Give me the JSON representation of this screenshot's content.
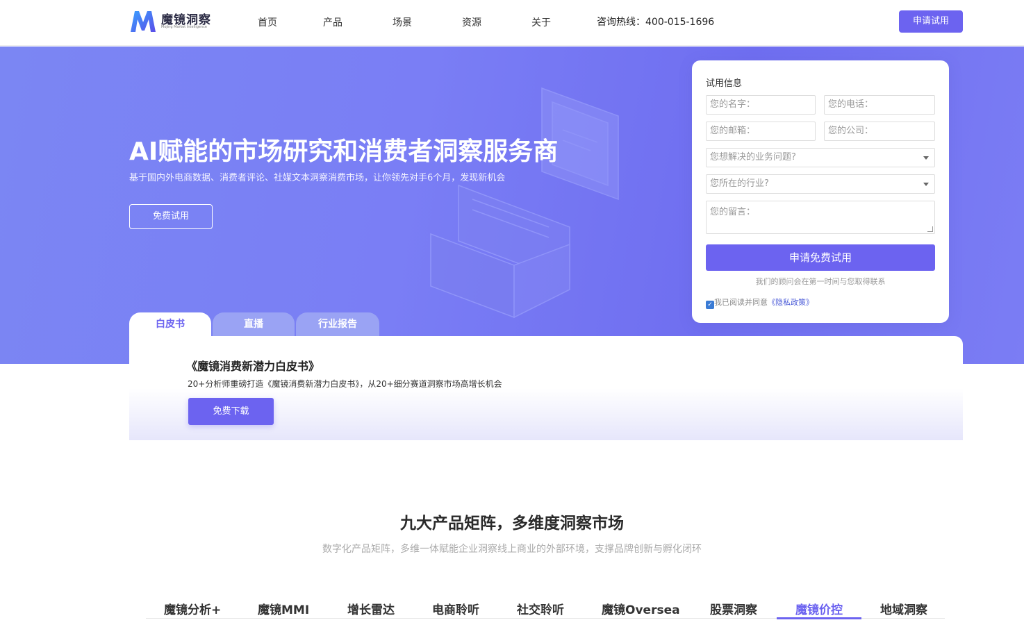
{
  "brand": {
    "name": "魔镜洞察",
    "tagline": "Mojing Market Intelligence",
    "accent": "#6c63f0"
  },
  "nav": {
    "items": [
      {
        "label": "首页"
      },
      {
        "label": "产品"
      },
      {
        "label": "场景"
      },
      {
        "label": "资源"
      },
      {
        "label": "关于"
      }
    ],
    "hotline": "咨询热线：400-015-1696",
    "cta_label": "申请试用"
  },
  "hero": {
    "title": "AI赋能的市场研究和消费者洞察服务商",
    "subtitle": "基于国内外电商数据、消费者评论、社媒文本洞察消费市场，让你领先对手6个月，发现新机会",
    "button_label": "免费试用"
  },
  "form": {
    "title": "试用信息",
    "name_placeholder": "您的名字：",
    "phone_placeholder": "您的电话：",
    "email_placeholder": "您的邮箱：",
    "company_placeholder": "您的公司：",
    "problem_select": "您想解决的业务问题?",
    "industry_select": "您所在的行业?",
    "message_placeholder": "您的留言：",
    "submit_label": "申请免费试用",
    "note": "我们的顾问会在第一时间与您取得联系",
    "agree_text": "我已阅读并同意",
    "privacy_link": "《隐私政策》",
    "agree_checked": true
  },
  "resource_tabs": [
    {
      "label": "白皮书",
      "active": true
    },
    {
      "label": "直播",
      "active": false
    },
    {
      "label": "行业报告",
      "active": false
    }
  ],
  "panel": {
    "title": "《魔镜消费新潜力白皮书》",
    "desc": "20+分析师重磅打造《魔镜消费新潜力白皮书》，从20+细分赛道洞察市场高增长机会",
    "button_label": "免费下载"
  },
  "products": {
    "title": "九大产品矩阵，多维度洞察市场",
    "subtitle": "数字化产品矩阵，多维一体赋能企业洞察线上商业的外部环境，支撑品牌创新与孵化闭环",
    "tabs": [
      {
        "label": "魔镜分析+"
      },
      {
        "label": "魔镜MMI"
      },
      {
        "label": "增长雷达"
      },
      {
        "label": "电商聆听"
      },
      {
        "label": "社交聆听"
      },
      {
        "label": "魔镜Oversea"
      },
      {
        "label": "股票洞察"
      },
      {
        "label": "魔镜价控"
      },
      {
        "label": "地域洞察"
      }
    ],
    "active_tab": "魔镜价控"
  }
}
